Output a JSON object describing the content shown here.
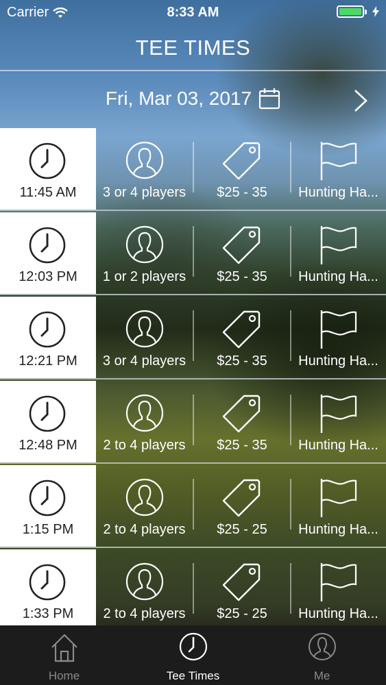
{
  "status_bar": {
    "carrier": "Carrier",
    "time": "8:33 AM"
  },
  "header": {
    "title": "TEE TIMES"
  },
  "date_bar": {
    "date": "Fri, Mar 03, 2017"
  },
  "tee_times": [
    {
      "time": "11:45 AM",
      "players": "3 or 4 players",
      "price": "$25 - 35",
      "course": "Hunting Ha..."
    },
    {
      "time": "12:03 PM",
      "players": "1 or 2 players",
      "price": "$25 - 35",
      "course": "Hunting Ha..."
    },
    {
      "time": "12:21 PM",
      "players": "3 or 4 players",
      "price": "$25 - 35",
      "course": "Hunting Ha..."
    },
    {
      "time": "12:48 PM",
      "players": "2 to 4 players",
      "price": "$25 - 35",
      "course": "Hunting Ha..."
    },
    {
      "time": "1:15 PM",
      "players": "2 to 4 players",
      "price": "$25 - 25",
      "course": "Hunting Ha..."
    },
    {
      "time": "1:33 PM",
      "players": "2 to 4 players",
      "price": "$25 - 25",
      "course": "Hunting Ha..."
    }
  ],
  "tab_bar": {
    "home": "Home",
    "tee_times": "Tee Times",
    "me": "Me"
  },
  "icons": {
    "time": "clock-icon",
    "players": "person-icon",
    "price": "price-tag-icon",
    "course": "flag-icon",
    "date": "calendar-icon",
    "next": "chevron-right-icon"
  },
  "colors": {
    "battery": "#4cd964",
    "tab_bar_bg": "#1c1c1c",
    "active_tab": "#ffffff",
    "inactive_tab": "#8a8a8a"
  }
}
